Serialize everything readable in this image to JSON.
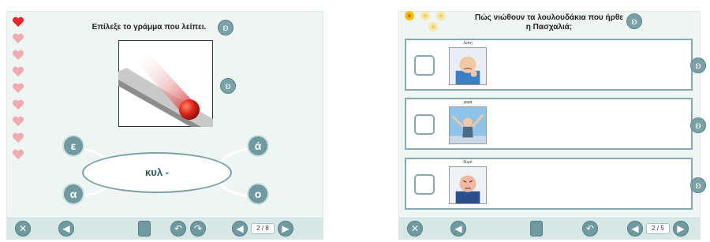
{
  "left_screen": {
    "question": "Επίλεξε το γράμμα που λείπει.",
    "hearts": {
      "total": 9,
      "filled": 1,
      "filled_color": "#e8262b",
      "empty_color": "#f2a9b0"
    },
    "icons": {
      "audio": "ear-icon",
      "image": "rolling-red-ball-image"
    },
    "word_fragment": "κυλ -",
    "letter_options": [
      "ε",
      "ά",
      "α",
      "ο"
    ],
    "page_indicator": "2 / 8",
    "toolbar_icons": [
      "exit-icon",
      "back-arrow-icon",
      "notes-icon",
      "undo-icon",
      "redo-icon",
      "prev-icon",
      "next-icon"
    ]
  },
  "right_screen": {
    "question_line1": "Πώς νιώθουν τα λουλουδάκια που ήρθε",
    "question_line2": "η Πασχαλιά;",
    "flowers": {
      "total": 4,
      "lit": 1,
      "lit_color": "#f2c400",
      "dim_color": "#f6e8a6"
    },
    "options": [
      {
        "label": "λύπη",
        "image": "sad-boy-image",
        "checked": false
      },
      {
        "label": "χαρά",
        "image": "happy-child-image",
        "checked": false
      },
      {
        "label": "θυμό",
        "image": "angry-boy-image",
        "checked": false
      }
    ],
    "page_indicator": "2 / 5",
    "toolbar_icons": [
      "exit-icon",
      "back-arrow-icon",
      "notes-icon",
      "undo-icon",
      "prev-icon",
      "next-icon"
    ]
  },
  "colors": {
    "background": "#eef6f4",
    "accent": "#6f9a9f",
    "toolbar": "#d6e7e5"
  }
}
